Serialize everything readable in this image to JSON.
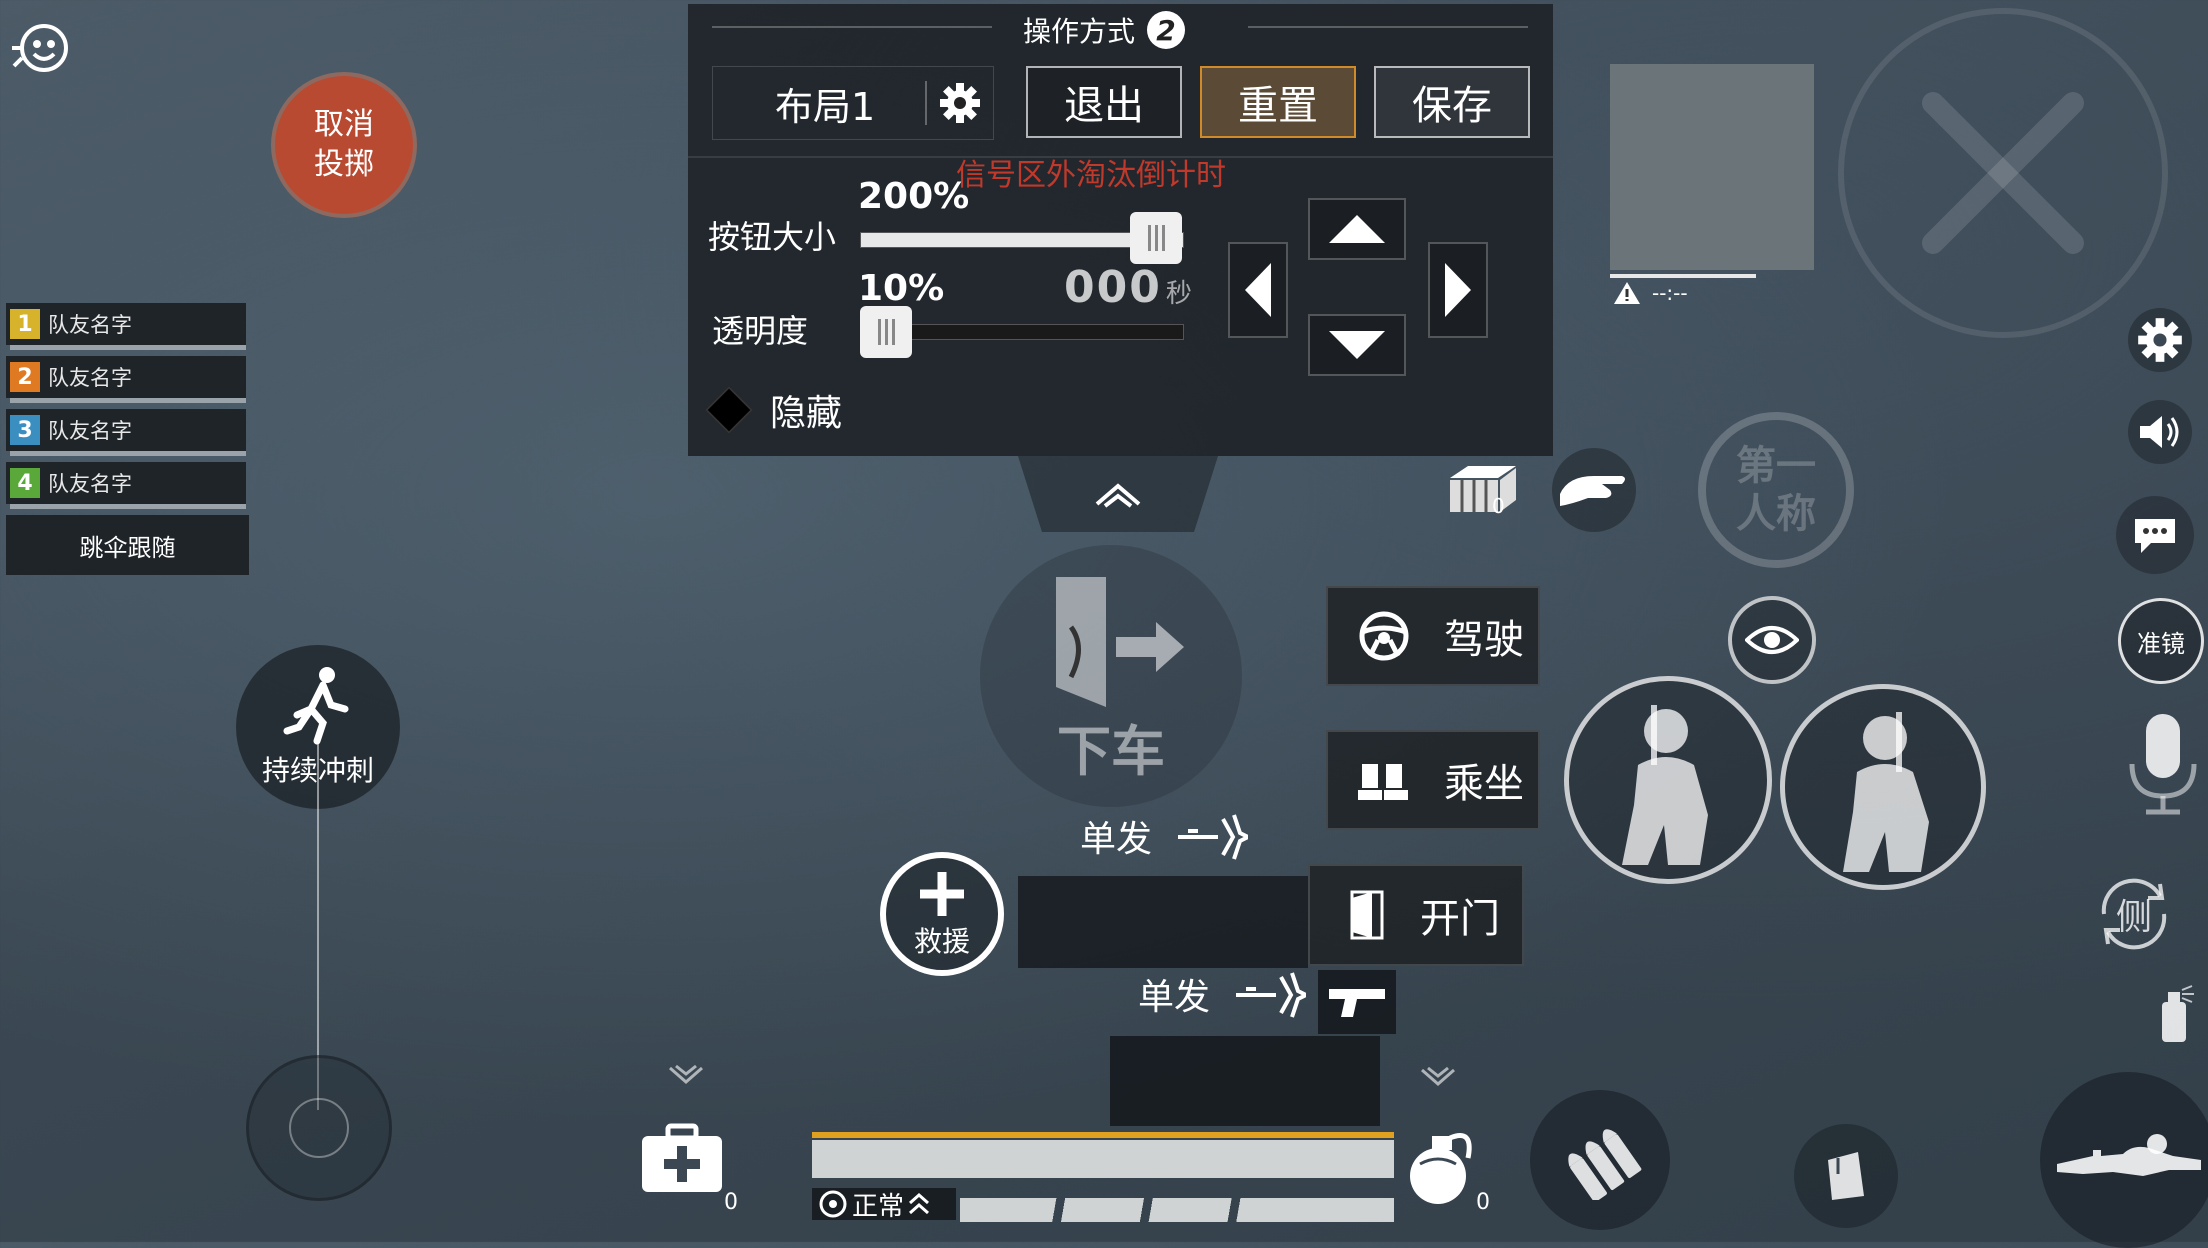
{
  "panel": {
    "title": "操作方式",
    "mode_number": "2",
    "layout_label": "布局1",
    "exit_label": "退出",
    "reset_label": "重置",
    "save_label": "保存",
    "warning_text": "信号区外淘汰倒计时",
    "size_label": "按钮大小",
    "size_value": "200%",
    "size_fraction": 1.0,
    "opacity_label": "透明度",
    "opacity_value": "10%",
    "opacity_fraction": 0.0,
    "hide_label": "隐藏",
    "timer_digits": "000",
    "timer_unit": "秒"
  },
  "top_left": {
    "cancel_throw_line1": "取消",
    "cancel_throw_line2": "投掷"
  },
  "team": {
    "members": [
      {
        "num": "1",
        "name": "队友名字",
        "color": "#d6b32a"
      },
      {
        "num": "2",
        "name": "队友名字",
        "color": "#e07a22"
      },
      {
        "num": "3",
        "name": "队友名字",
        "color": "#3a8fc0"
      },
      {
        "num": "4",
        "name": "队友名字",
        "color": "#5aa83a"
      }
    ],
    "follow_label": "跳伞跟随"
  },
  "sprint_label": "持续冲刺",
  "exit_vehicle_label": "下车",
  "actions": {
    "drive_label": "驾驶",
    "ride_label": "乘坐",
    "open_door_label": "开门",
    "rescue_label": "救援",
    "single_fire_1": "单发",
    "single_fire_2": "单发"
  },
  "minimap": {
    "time_text": "--:--"
  },
  "right_controls": {
    "first_person_line1": "第一",
    "first_person_line2": "人称",
    "scope_label": "准镜",
    "lean_label": "侧"
  },
  "bottom": {
    "status_text": "正常",
    "medkit_count": "0",
    "grenade_count": "0",
    "crate_count": "0"
  },
  "colors": {
    "accent_orange": "#e0a020",
    "reset_border": "#d08a2a",
    "cancel_throw_red": "#b94a32",
    "warning_red": "#c0392b"
  }
}
